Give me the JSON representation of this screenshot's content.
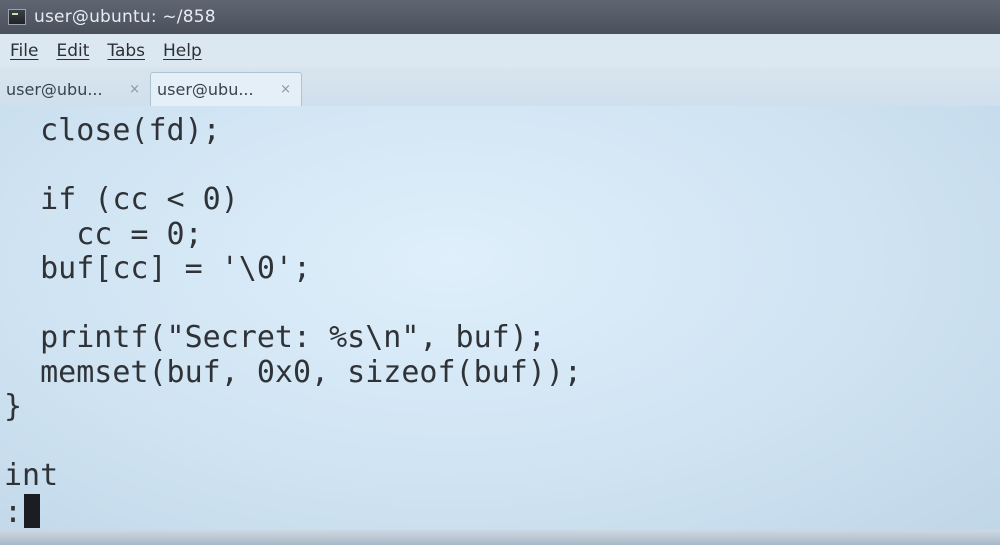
{
  "window": {
    "title": "user@ubuntu: ~/858"
  },
  "menu": {
    "items": [
      "File",
      "Edit",
      "Tabs",
      "Help"
    ]
  },
  "tabs": [
    {
      "label": "user@ubu...",
      "close": "×",
      "active": false
    },
    {
      "label": "user@ubu...",
      "close": "×",
      "active": true
    }
  ],
  "terminal": {
    "lines": [
      "  close(fd);",
      "",
      "  if (cc < 0)",
      "    cc = 0;",
      "  buf[cc] = '\\0';",
      "",
      "  printf(\"Secret: %s\\n\", buf);",
      "  memset(buf, 0x0, sizeof(buf));",
      "}",
      "",
      "int"
    ],
    "prompt": ":"
  },
  "colors": {
    "titlebar": "#4f5661",
    "terminal_bg": "#d6e8f5",
    "text": "#2f3338"
  }
}
